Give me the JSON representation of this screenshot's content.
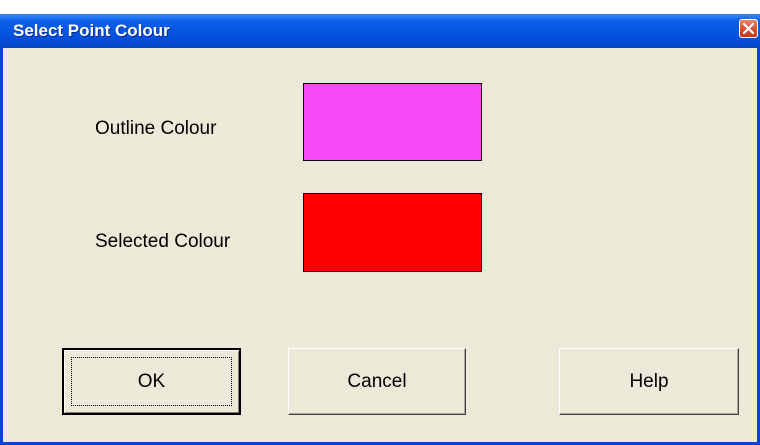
{
  "window": {
    "title": "Select Point Colour"
  },
  "fields": [
    {
      "label": "Outline Colour",
      "color": "#f54af5"
    },
    {
      "label": "Selected Colour",
      "color": "#ff0000"
    }
  ],
  "buttons": {
    "ok": "OK",
    "cancel": "Cancel",
    "help": "Help"
  },
  "icons": {
    "close": "close-icon"
  },
  "colors": {
    "titlebar": "#0553e1",
    "background": "#ece9d8",
    "close_button": "#d9532b"
  }
}
